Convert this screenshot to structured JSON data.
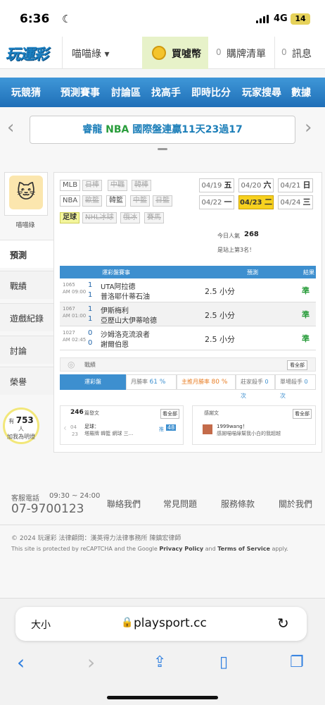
{
  "status_bar": {
    "time": "6:36",
    "network": "4G",
    "battery": "14"
  },
  "header": {
    "logo": "玩運彩",
    "user": "喵喵綠 ▾",
    "buy": "買噓幣",
    "cart_count": "0",
    "cart": "購牌清單",
    "msg_count": "0",
    "msg": "訊息"
  },
  "nav": [
    "玩競猜",
    "預測賽事",
    "討論區",
    "找高手",
    "即時比分",
    "玩家搜尋",
    "數據"
  ],
  "banner": {
    "title_a": "睿龍",
    "title_b": "NBA",
    "title_c": "國際盤連贏11天23過17"
  },
  "profile": {
    "name": "喵喵綠",
    "tabs": [
      "預測",
      "戰績",
      "遊戲紀錄",
      "討論",
      "榮譽"
    ],
    "fans_pre": "有",
    "fans": "753",
    "fans_unit": "人",
    "fans_post": "加我為明燈"
  },
  "leagues": [
    "MLB",
    "日棒",
    "中職",
    "韓棒",
    "NBA",
    "歐籃",
    "韓籃",
    "中籃",
    "日籃",
    "足球",
    "NHL冰球",
    "俄冰",
    "賽馬"
  ],
  "dates": [
    {
      "d": "04/19",
      "w": "五"
    },
    {
      "d": "04/20",
      "w": "六"
    },
    {
      "d": "04/21",
      "w": "日"
    },
    {
      "d": "04/22",
      "w": "一"
    },
    {
      "d": "04/23",
      "w": "二"
    },
    {
      "d": "04/24",
      "w": "三"
    }
  ],
  "popularity": {
    "label": "今日人氣",
    "value": "268",
    "rank": "是站上第3名！"
  },
  "table": {
    "h1": "運彩盤賽事",
    "h2": "預測",
    "h3": "結果",
    "rows": [
      {
        "id": "1065",
        "time": "AM 09:00",
        "s1": "1",
        "s2": "1",
        "t1": "UTA阿拉德",
        "t2": "普洛耶什蒂石油",
        "pred": "2.5 小分",
        "res": "準"
      },
      {
        "id": "1067",
        "time": "AM 01:00",
        "s1": "1",
        "s2": "1",
        "t1": "伊斯梅利",
        "t2": "亞歷山大伊蒂哈德",
        "pred": "2.5 小分",
        "res": "準"
      },
      {
        "id": "1027",
        "time": "AM 02:45",
        "s1": "0",
        "s2": "0",
        "t1": "沙姆洛克流浪者",
        "t2": "謝爾伯恩",
        "pred": "2.5 小分",
        "res": "準"
      }
    ]
  },
  "record": {
    "title": "戰績",
    "more": "看全部",
    "tab": "運彩盤",
    "win_label": "月勝率",
    "win": "61 %",
    "mwin_label": "主推月勝率",
    "mwin": "80 %",
    "streak_label": "莊家殺手",
    "streak": "0 次",
    "single_label": "單場殺手",
    "single": "0 次"
  },
  "posts": {
    "count": "246",
    "label": "篇發文",
    "more": "看全部",
    "date_d": "04",
    "date_n": "23",
    "author": "足球：",
    "preview": "塔羅牌 韓籃 網球 三...",
    "pushed": "推",
    "push_count": "48"
  },
  "thanks": {
    "label": "感謝文",
    "more": "看全部",
    "who": "1999wang！",
    "text": "感謝喵喵綠幫我小白的我超越"
  },
  "footer": {
    "svc_label": "客服電話",
    "svc_hours": "09:30 ~ 24:00",
    "phone": "07-9700123",
    "links": [
      "聯絡我們",
      "常見問題",
      "服務條款",
      "關於我們"
    ],
    "copy": "© 2024 玩運彩 法律顧問：漢英得力法律事務所 陳鎮宏律師",
    "recaptcha_pre": "This site is protected by reCAPTCHA and the Google",
    "privacy": "Privacy Policy",
    "and": "and",
    "terms": "Terms of Service",
    "apply": "apply."
  },
  "browser": {
    "text_size": "大小",
    "url": "playsport.cc"
  }
}
